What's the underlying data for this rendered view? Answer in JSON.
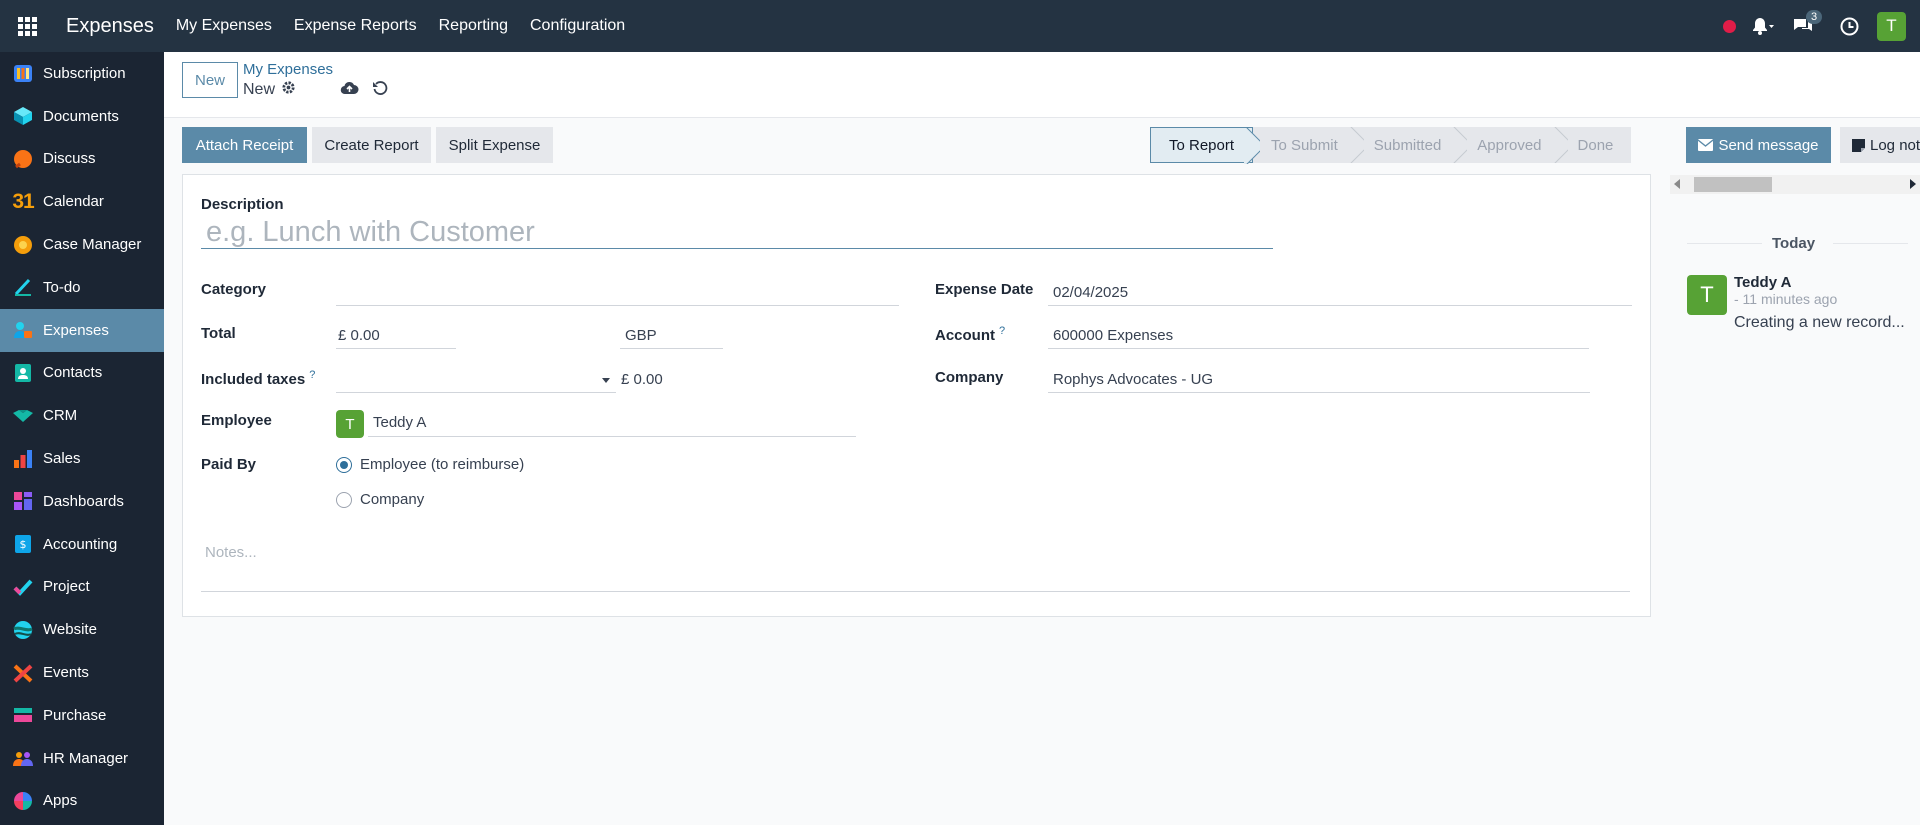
{
  "topbar": {
    "brand": "Expenses",
    "menu": [
      "My Expenses",
      "Expense Reports",
      "Reporting",
      "Configuration"
    ],
    "chat_count": "3",
    "user_initial": "T"
  },
  "sidebar": {
    "items": [
      {
        "label": "Subscription",
        "icon": "subscription-icon"
      },
      {
        "label": "Documents",
        "icon": "documents-icon"
      },
      {
        "label": "Discuss",
        "icon": "discuss-icon"
      },
      {
        "label": "Calendar",
        "icon": "calendar-icon"
      },
      {
        "label": "Case Manager",
        "icon": "case-manager-icon"
      },
      {
        "label": "To-do",
        "icon": "todo-icon"
      },
      {
        "label": "Expenses",
        "icon": "expenses-icon",
        "active": true
      },
      {
        "label": "Contacts",
        "icon": "contacts-icon"
      },
      {
        "label": "CRM",
        "icon": "crm-icon"
      },
      {
        "label": "Sales",
        "icon": "sales-icon"
      },
      {
        "label": "Dashboards",
        "icon": "dashboards-icon"
      },
      {
        "label": "Accounting",
        "icon": "accounting-icon"
      },
      {
        "label": "Project",
        "icon": "project-icon"
      },
      {
        "label": "Website",
        "icon": "website-icon"
      },
      {
        "label": "Events",
        "icon": "events-icon"
      },
      {
        "label": "Purchase",
        "icon": "purchase-icon"
      },
      {
        "label": "HR Manager",
        "icon": "hr-manager-icon"
      },
      {
        "label": "Apps",
        "icon": "apps-icon"
      }
    ],
    "calendar_day": "31"
  },
  "control": {
    "new_button": "New",
    "breadcrumb_parent": "My Expenses",
    "breadcrumb_current": "New"
  },
  "actions": {
    "attach_receipt": "Attach Receipt",
    "create_report": "Create Report",
    "split_expense": "Split Expense"
  },
  "status": {
    "stages": [
      "To Report",
      "To Submit",
      "Submitted",
      "Approved",
      "Done"
    ],
    "current": "To Report"
  },
  "form": {
    "description_label": "Description",
    "description_placeholder": "e.g. Lunch with Customer",
    "category_label": "Category",
    "category_value": "",
    "total_label": "Total",
    "total_value": "£ 0.00",
    "currency": "GBP",
    "taxes_label": "Included taxes",
    "taxes_amount": "£ 0.00",
    "help_mark": "?",
    "employee_label": "Employee",
    "employee_initial": "T",
    "employee_value": "Teddy A",
    "paid_by_label": "Paid By",
    "paid_by_options": [
      "Employee (to reimburse)",
      "Company"
    ],
    "paid_by_selected": "Employee (to reimburse)",
    "expense_date_label": "Expense Date",
    "expense_date_value": "02/04/2025",
    "account_label": "Account",
    "account_value": "600000 Expenses",
    "company_label": "Company",
    "company_value": "Rophys Advocates - UG",
    "notes_placeholder": "Notes..."
  },
  "chatter": {
    "send_message": "Send message",
    "log_note": "Log note",
    "today": "Today",
    "message": {
      "author_initial": "T",
      "author": "Teddy A",
      "time": "- 11 minutes ago",
      "body": "Creating a new record..."
    }
  },
  "colors": {
    "navbar": "#243342",
    "sidebar": "#1b2533",
    "accent": "#5b8aa8",
    "avatar_green": "#57a235"
  }
}
